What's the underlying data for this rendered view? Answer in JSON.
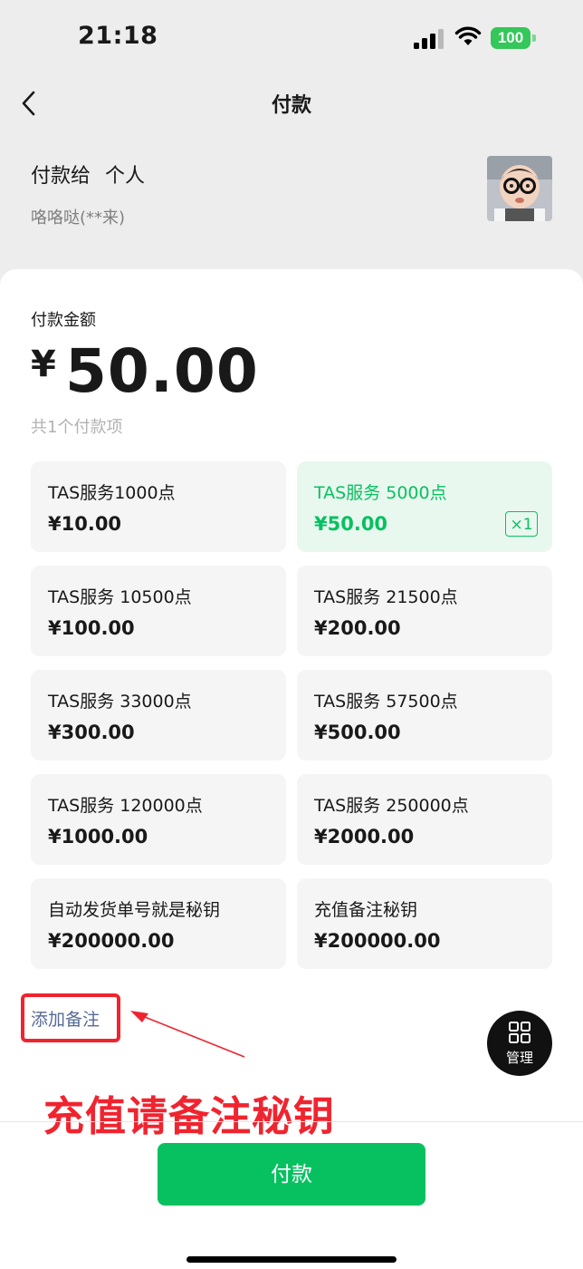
{
  "status_bar": {
    "time": "21:18",
    "battery": "100"
  },
  "nav": {
    "title": "付款"
  },
  "payee": {
    "label": "付款给",
    "type": "个人",
    "name": "咯咯哒(**来)"
  },
  "amount": {
    "label": "付款金额",
    "currency": "¥",
    "value": "50.00",
    "item_count": "共1个付款项"
  },
  "items": [
    {
      "name": "TAS服务1000点",
      "price": "¥10.00",
      "selected": false
    },
    {
      "name": "TAS服务 5000点",
      "price": "¥50.00",
      "selected": true,
      "quantity": "×1"
    },
    {
      "name": "TAS服务 10500点",
      "price": "¥100.00",
      "selected": false
    },
    {
      "name": "TAS服务 21500点",
      "price": "¥200.00",
      "selected": false
    },
    {
      "name": "TAS服务 33000点",
      "price": "¥300.00",
      "selected": false
    },
    {
      "name": "TAS服务 57500点",
      "price": "¥500.00",
      "selected": false
    },
    {
      "name": "TAS服务 120000点",
      "price": "¥1000.00",
      "selected": false
    },
    {
      "name": "TAS服务 250000点",
      "price": "¥2000.00",
      "selected": false
    },
    {
      "name": "自动发货单号就是秘钥",
      "price": "¥200000.00",
      "selected": false
    },
    {
      "name": "充值备注秘钥",
      "price": "¥200000.00",
      "selected": false
    }
  ],
  "remark": {
    "link": "添加备注"
  },
  "manage": {
    "label": "管理"
  },
  "annotation": {
    "text": "充值请备注秘钥"
  },
  "pay_button": {
    "label": "付款"
  },
  "colors": {
    "accent": "#07c160",
    "selected_bg": "#e9f8ef",
    "annotation_red": "#f0242f",
    "link": "#576b95"
  }
}
